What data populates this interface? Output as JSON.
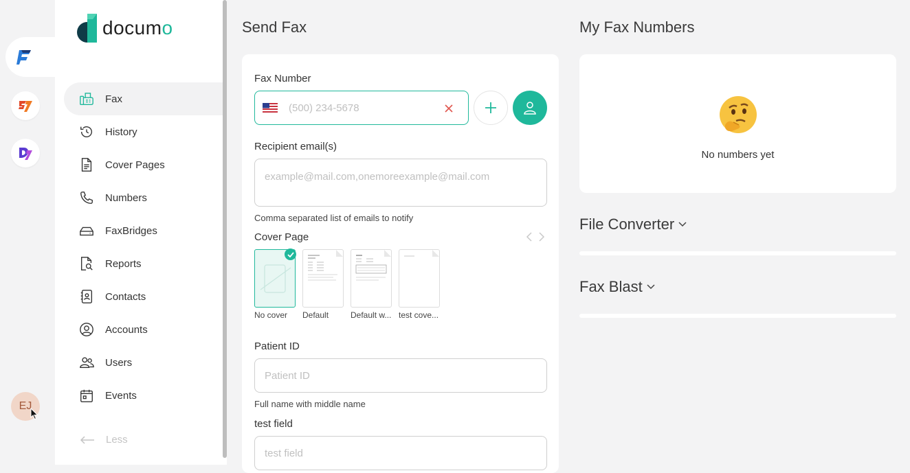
{
  "rail": {
    "apps": [
      "fax-app-icon",
      "sign-app-icon",
      "docs-app-icon"
    ],
    "avatar_initials": "EJ"
  },
  "brand": {
    "name_pre": "docu",
    "name_accent": "m",
    "name_post": "o"
  },
  "nav": {
    "items": [
      {
        "label": "Fax",
        "icon": "fax-icon"
      },
      {
        "label": "History",
        "icon": "history-icon"
      },
      {
        "label": "Cover Pages",
        "icon": "document-icon"
      },
      {
        "label": "Numbers",
        "icon": "phone-icon"
      },
      {
        "label": "FaxBridges",
        "icon": "device-icon"
      },
      {
        "label": "Reports",
        "icon": "report-icon"
      },
      {
        "label": "Contacts",
        "icon": "contacts-icon"
      },
      {
        "label": "Accounts",
        "icon": "account-icon"
      },
      {
        "label": "Users",
        "icon": "users-icon"
      },
      {
        "label": "Events",
        "icon": "calendar-icon"
      }
    ],
    "less_label": "Less"
  },
  "send_fax": {
    "title": "Send Fax",
    "fax_number_label": "Fax Number",
    "fax_number_placeholder": "(500) 234-5678",
    "recipient_label": "Recipient email(s)",
    "recipient_placeholder": "example@mail.com,onemoreexample@mail.com",
    "recipient_hint": "Comma separated list of emails to notify",
    "cover_label": "Cover Page",
    "covers": [
      "No cover",
      "Default",
      "Default w...",
      "test cove..."
    ],
    "patient_label": "Patient ID",
    "patient_placeholder": "Patient ID",
    "patient_hint": "Full name with middle name",
    "test_label": "test field",
    "test_placeholder": "test field"
  },
  "my_numbers": {
    "title": "My Fax Numbers",
    "empty_text": "No numbers yet"
  },
  "file_converter": {
    "title": "File Converter"
  },
  "fax_blast": {
    "title": "Fax Blast"
  },
  "colors": {
    "accent": "#1fb89b",
    "danger": "#e0574f"
  }
}
